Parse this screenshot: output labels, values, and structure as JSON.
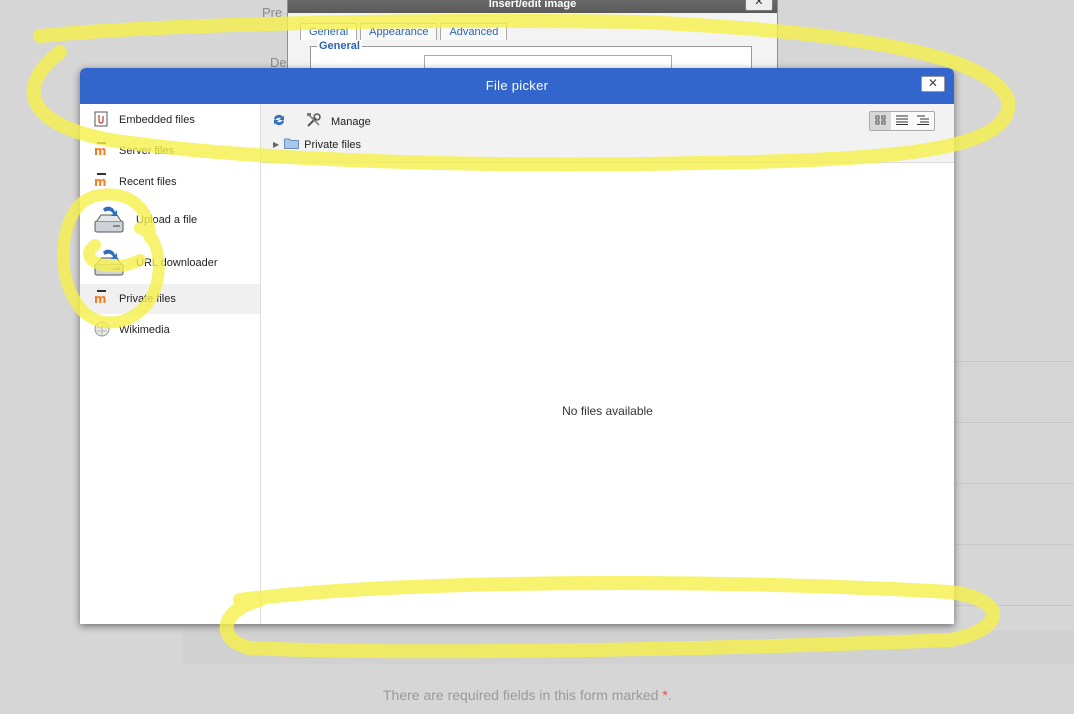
{
  "background": {
    "label_pre": "Pre",
    "label_de": "De",
    "required_note": "There are required fields in this form marked",
    "required_symbol": "*",
    "required_end": "."
  },
  "image_dialog": {
    "title": "Insert/edit image",
    "close_label": "✕",
    "tabs": [
      {
        "label": "General"
      },
      {
        "label": "Appearance"
      },
      {
        "label": "Advanced"
      }
    ],
    "section_legend": "General"
  },
  "file_picker": {
    "title": "File picker",
    "close_label": "✕",
    "repositories": [
      {
        "label": "Embedded files",
        "icon": "embedded-file-icon"
      },
      {
        "label": "Server files",
        "icon": "moodle-icon"
      },
      {
        "label": "Recent files",
        "icon": "moodle-icon"
      },
      {
        "label": "Upload a file",
        "icon": "upload-icon"
      },
      {
        "label": "URL downloader",
        "icon": "url-download-icon"
      },
      {
        "label": "Private files",
        "icon": "moodle-icon",
        "active": true
      },
      {
        "label": "Wikimedia",
        "icon": "wikimedia-icon"
      }
    ],
    "toolbar": {
      "refresh_icon": "refresh-icon",
      "manage_label": "Manage",
      "manage_icon": "tools-icon"
    },
    "path": {
      "label": "Private files"
    },
    "view_modes": [
      "icons",
      "list",
      "tree"
    ],
    "empty_message": "No files available"
  },
  "colors": {
    "header_blue": "#3366cc",
    "highlighter_yellow": "#f5f04a",
    "moodle_orange": "#f47d20"
  }
}
